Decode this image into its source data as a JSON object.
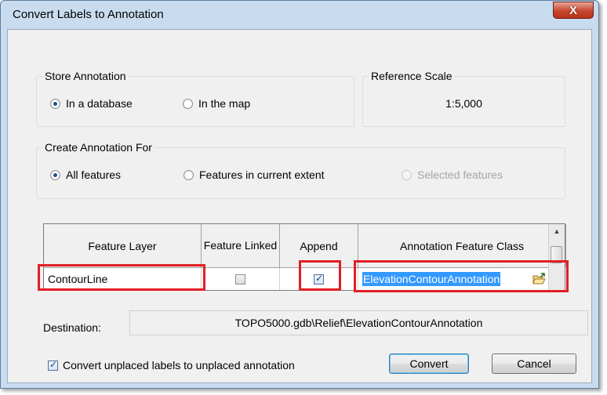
{
  "window": {
    "title": "Convert Labels to Annotation",
    "close_label": "X"
  },
  "store_annotation": {
    "title": "Store Annotation",
    "options": [
      {
        "label": "In a database",
        "selected": true
      },
      {
        "label": "In the map",
        "selected": false
      }
    ]
  },
  "reference_scale": {
    "title": "Reference Scale",
    "value": "1:5,000"
  },
  "create_annotation_for": {
    "title": "Create Annotation For",
    "options": [
      {
        "label": "All features",
        "selected": true,
        "enabled": true
      },
      {
        "label": "Features in current extent",
        "selected": false,
        "enabled": true
      },
      {
        "label": "Selected features",
        "selected": false,
        "enabled": false
      }
    ]
  },
  "grid": {
    "columns": [
      "Feature Layer",
      "Feature Linked",
      "Append",
      "Annotation Feature Class"
    ],
    "rows": [
      {
        "feature_layer": "ContourLine",
        "feature_linked": false,
        "append": true,
        "annotation_feature_class": "ElevationContourAnnotation"
      }
    ]
  },
  "destination": {
    "label": "Destination:",
    "value": "TOPO5000.gdb\\Relief\\ElevationContourAnnotation"
  },
  "options": {
    "convert_unplaced_label": "Convert unplaced labels to unplaced annotation",
    "convert_unplaced_checked": true
  },
  "buttons": {
    "convert": "Convert",
    "cancel": "Cancel"
  },
  "highlight_color": "#e31e24"
}
